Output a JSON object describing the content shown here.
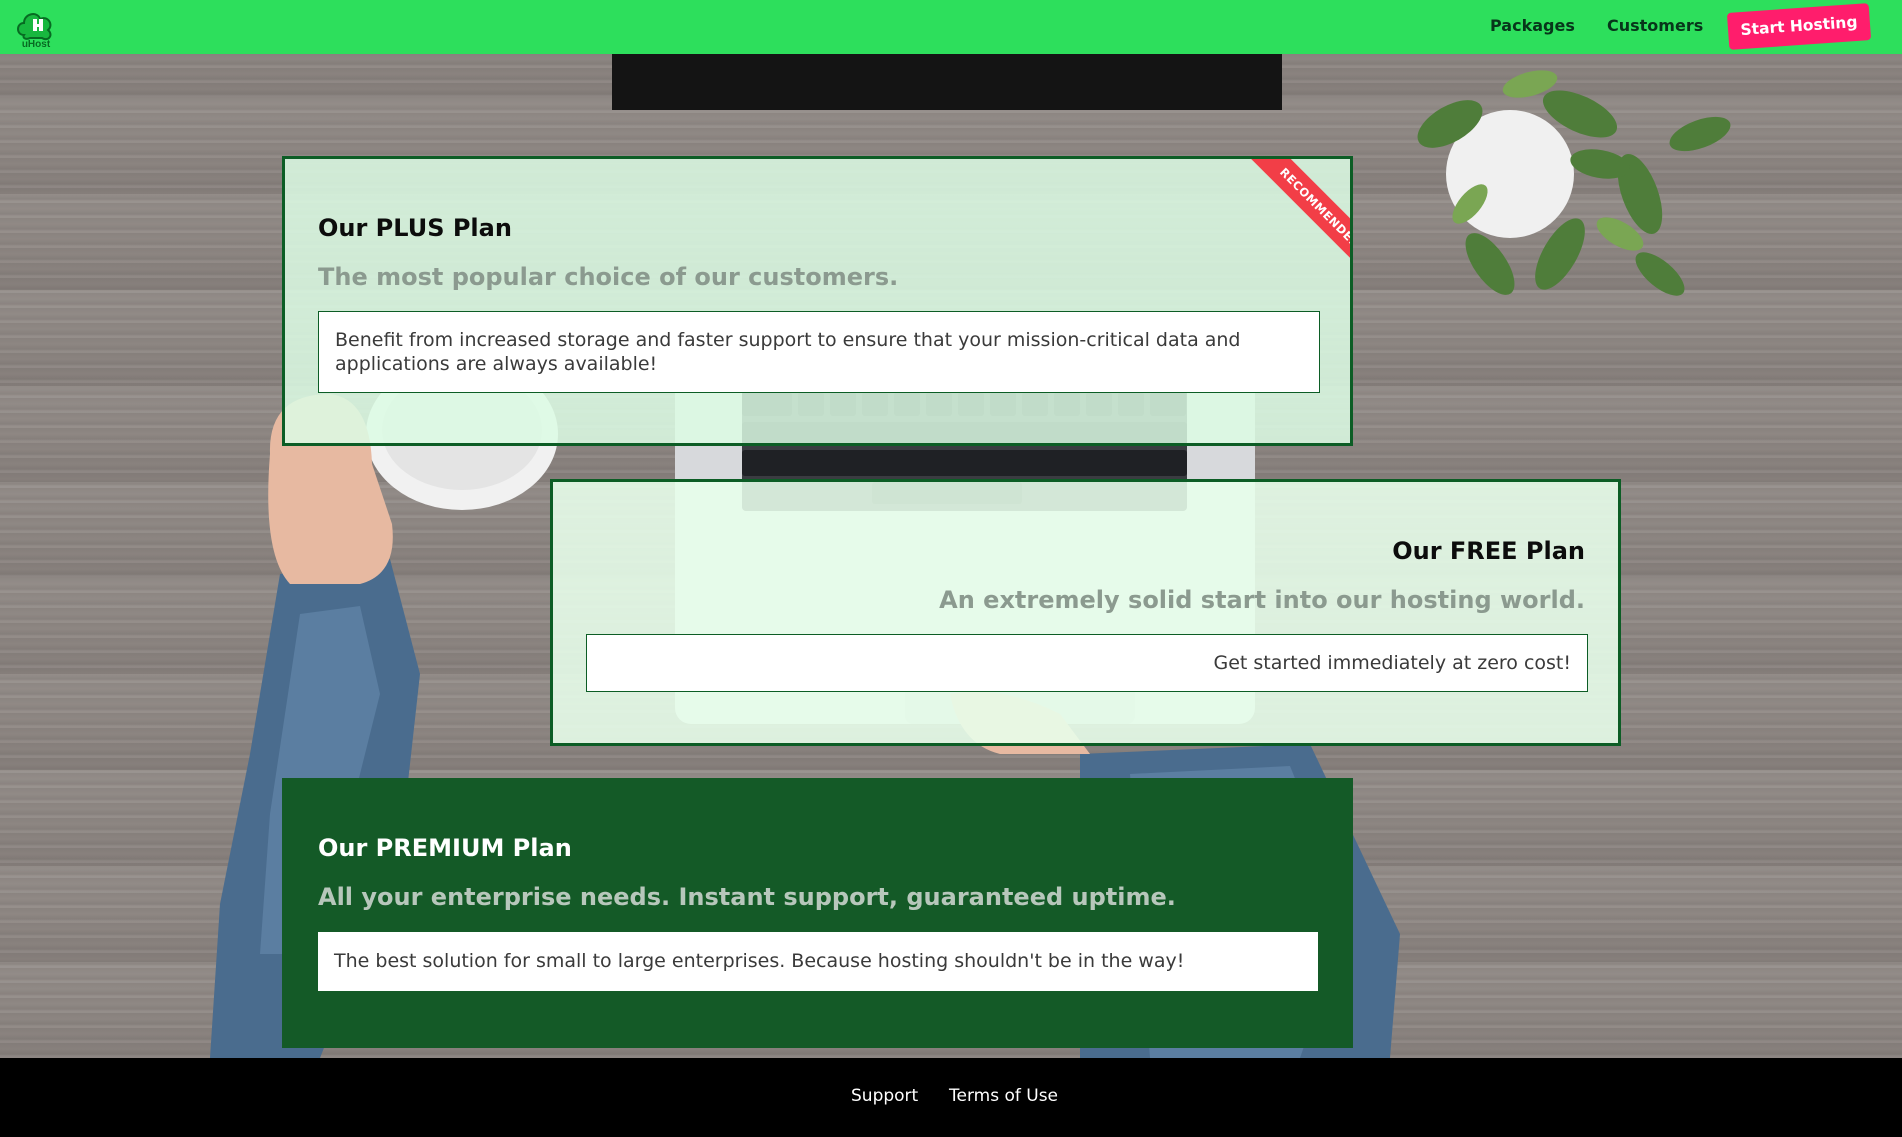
{
  "header": {
    "logo_text": "uHost",
    "nav": {
      "packages": "Packages",
      "customers": "Customers",
      "cta": "Start Hosting"
    }
  },
  "plans": {
    "plus": {
      "title": "Our PLUS Plan",
      "subtitle": "The most popular choice of our customers.",
      "description": "Benefit from increased storage and faster support to ensure that your mission-critical data and applications are always available!",
      "badge": "RECOMMENDED"
    },
    "free": {
      "title": "Our FREE Plan",
      "subtitle": "An extremely solid start into our hosting world.",
      "description": "Get started immediately at zero cost!"
    },
    "premium": {
      "title": "Our PREMIUM Plan",
      "subtitle": "All your enterprise needs. Instant support, guaranteed uptime.",
      "description": "The best solution for small to large enterprises. Because hosting shouldn't be in the way!"
    }
  },
  "footer": {
    "support": "Support",
    "terms": "Terms of Use"
  },
  "colors": {
    "header_bg": "#2ddf5c",
    "cta_bg": "#ff1d6c",
    "card_border": "#0c5d25",
    "premium_bg": "#145a27",
    "ribbon_bg": "#f23e47",
    "footer_bg": "#000000"
  }
}
